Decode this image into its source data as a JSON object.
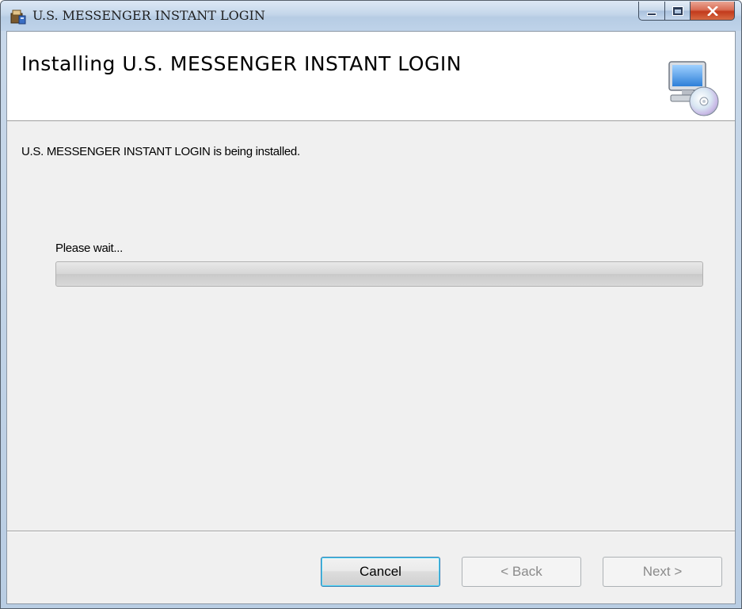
{
  "window": {
    "title": "U.S. MESSENGER INSTANT LOGIN",
    "icons": {
      "app": "installer-package-icon",
      "minimize": "minimize-icon",
      "maximize": "maximize-icon",
      "close": "close-icon"
    }
  },
  "banner": {
    "title": "Installing U.S. MESSENGER INSTANT LOGIN",
    "icon": "computer-with-cd-icon"
  },
  "body": {
    "description": "U.S. MESSENGER INSTANT LOGIN is being installed.",
    "progress_label": "Please wait...",
    "progress_value": 0
  },
  "buttons": {
    "cancel": "Cancel",
    "back": "< Back",
    "next": "Next >"
  },
  "colors": {
    "client_background": "#f0f0f0",
    "banner_background": "#ffffff",
    "close_button": "#c33a1c",
    "focus_border": "#3c7fb1"
  }
}
